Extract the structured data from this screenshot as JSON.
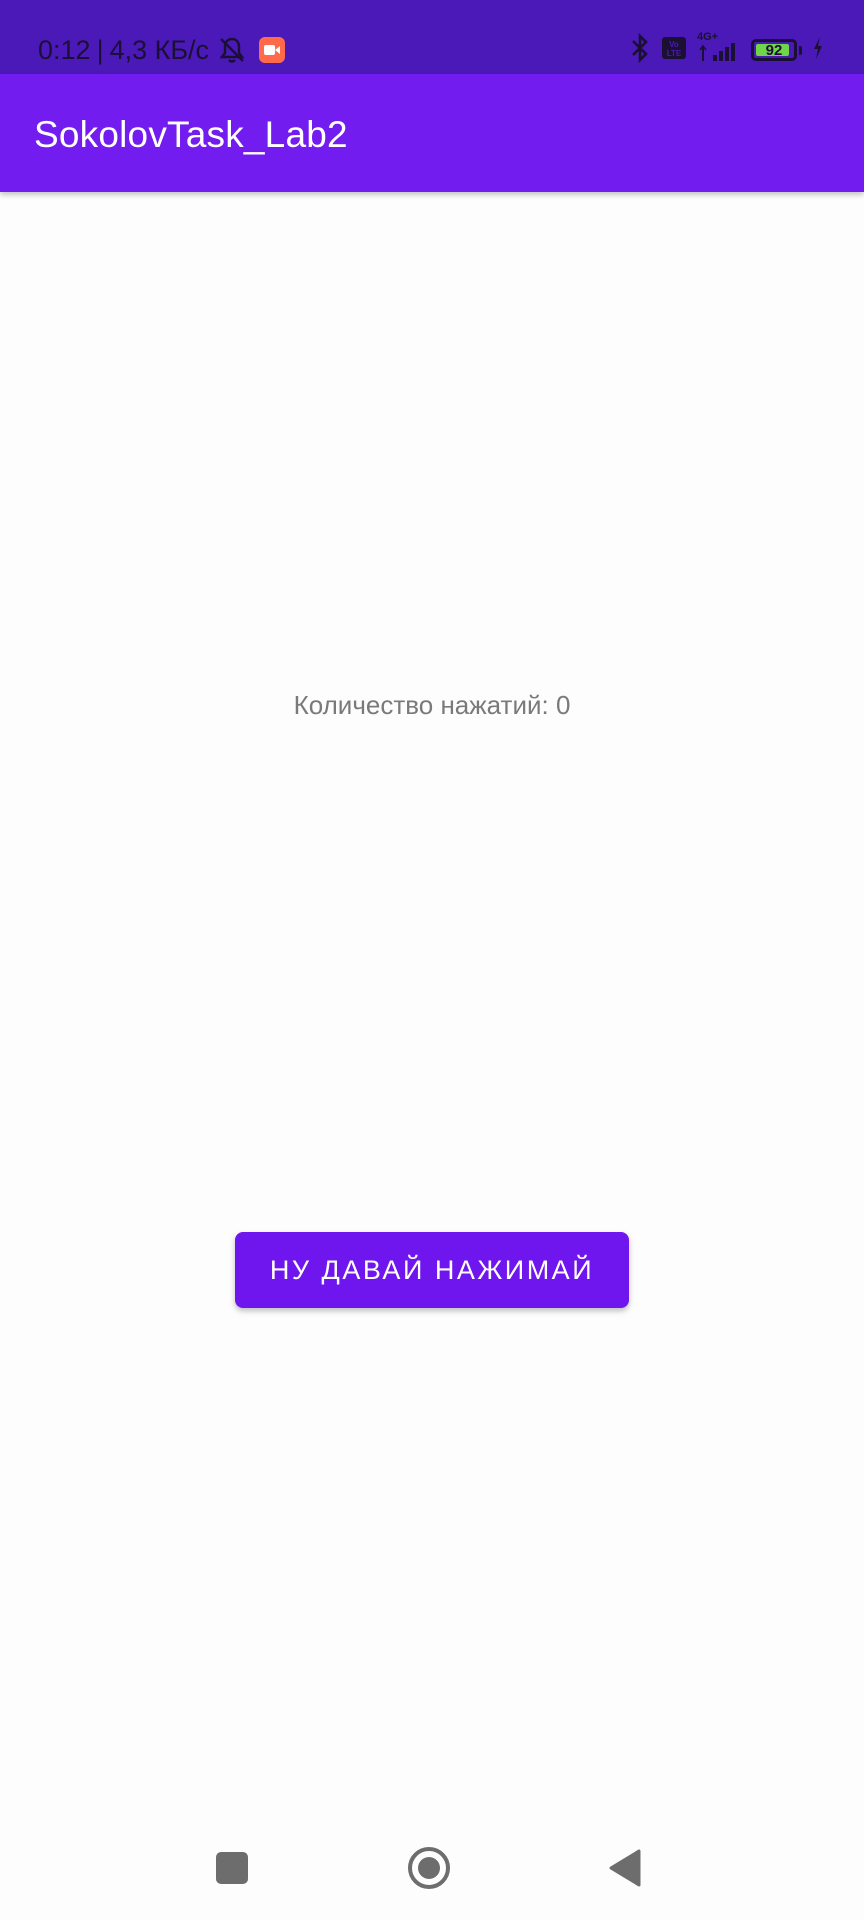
{
  "status_bar": {
    "time": "0:12",
    "separator": "|",
    "network_speed": "4,3 КБ/с",
    "network_type": "4G+",
    "volte_label": "Vo LTE",
    "battery_level": "92",
    "icons": [
      "muted-alarm-icon",
      "screen-record-icon",
      "bluetooth-icon",
      "volte-icon",
      "signal-icon",
      "battery-icon",
      "charging-icon"
    ],
    "colors": {
      "background": "#4a19b8",
      "record": "#ff6b4a",
      "battery_fill": "#6fd64a"
    }
  },
  "app_bar": {
    "title": "SokolovTask_Lab2",
    "color": "#731cef"
  },
  "main": {
    "counter_text": "Количество нажатий: 0",
    "button_label": "НУ ДАВАЙ НАЖИМАЙ",
    "button_color": "#6f16ee"
  },
  "nav_bar": {
    "icons": [
      "recents-square-icon",
      "home-circle-icon",
      "back-triangle-icon"
    ]
  }
}
